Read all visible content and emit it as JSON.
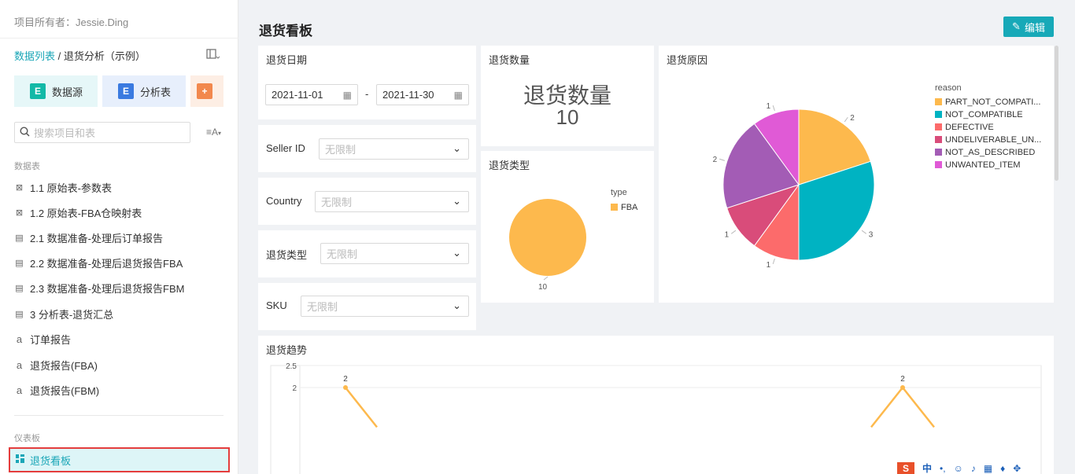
{
  "sidebar": {
    "owner": "项目所有者：Jessie.Ding",
    "breadcrumb_link": "数据列表",
    "breadcrumb_sep": " / ",
    "breadcrumb_current": "退货分析（示例）",
    "tools": {
      "datasource": "数据源",
      "analysis": "分析表"
    },
    "search_placeholder": "搜索项目和表",
    "section_tables": "数据表",
    "items": [
      {
        "label": "1.1 原始表-参数表",
        "icon": "table-raw-icon"
      },
      {
        "label": "1.2 原始表-FBA仓映射表",
        "icon": "table-raw-icon"
      },
      {
        "label": "2.1 数据准备-处理后订单报告",
        "icon": "doc-icon"
      },
      {
        "label": "2.2 数据准备-处理后退货报告FBA",
        "icon": "doc-icon"
      },
      {
        "label": "2.3 数据准备-处理后退货报告FBM",
        "icon": "doc-icon"
      },
      {
        "label": "3 分析表-退货汇总",
        "icon": "doc-icon"
      },
      {
        "label": "订单报告",
        "icon": "amazon-icon"
      },
      {
        "label": "退货报告(FBA)",
        "icon": "amazon-icon"
      },
      {
        "label": "退货报告(FBM)",
        "icon": "amazon-icon"
      }
    ],
    "section_dashboards": "仪表板",
    "active_dashboard": "退货看板"
  },
  "main": {
    "title": "退货看板",
    "edit_label": "编辑",
    "date_filter": {
      "title": "退货日期",
      "start": "2021-11-01",
      "sep": "-",
      "end": "2021-11-30"
    },
    "filters": [
      {
        "label": "Seller ID",
        "placeholder": "无限制"
      },
      {
        "label": "Country",
        "placeholder": "无限制"
      },
      {
        "label": "退货类型",
        "placeholder": "无限制"
      },
      {
        "label": "SKU",
        "placeholder": "无限制"
      }
    ],
    "kpi": {
      "title": "退货数量",
      "label": "退货数量",
      "value": "10"
    },
    "type_chart_title": "退货类型",
    "reason_chart_title": "退货原因",
    "trend_chart_title": "退货趋势"
  },
  "chart_data": [
    {
      "type": "pie",
      "legend_title": "type",
      "labels": [
        "FBA"
      ],
      "values": [
        10
      ],
      "colors": [
        "#fdb94d"
      ],
      "legend": "top-right"
    },
    {
      "type": "pie",
      "legend_title": "reason",
      "labels": [
        "PART_NOT_COMPATI...",
        "NOT_COMPATIBLE",
        "DEFECTIVE",
        "UNDELIVERABLE_UN...",
        "NOT_AS_DESCRIBED",
        "UNWANTED_ITEM"
      ],
      "values": [
        2,
        3,
        1,
        1,
        2,
        1
      ],
      "colors": [
        "#fdb94d",
        "#00b3c2",
        "#fc6b6b",
        "#d94c7a",
        "#a35cb5",
        "#e05ad6"
      ],
      "legend": "top-right"
    },
    {
      "type": "line",
      "y_ticks": [
        "2.5",
        "2"
      ],
      "ylim": [
        0,
        2.5
      ],
      "points": [
        {
          "x_frac": 0.0,
          "value": 2,
          "label": "2"
        },
        {
          "x_frac": 1.0,
          "value": 2,
          "label": "2"
        }
      ],
      "color": "#fdb94d"
    }
  ]
}
